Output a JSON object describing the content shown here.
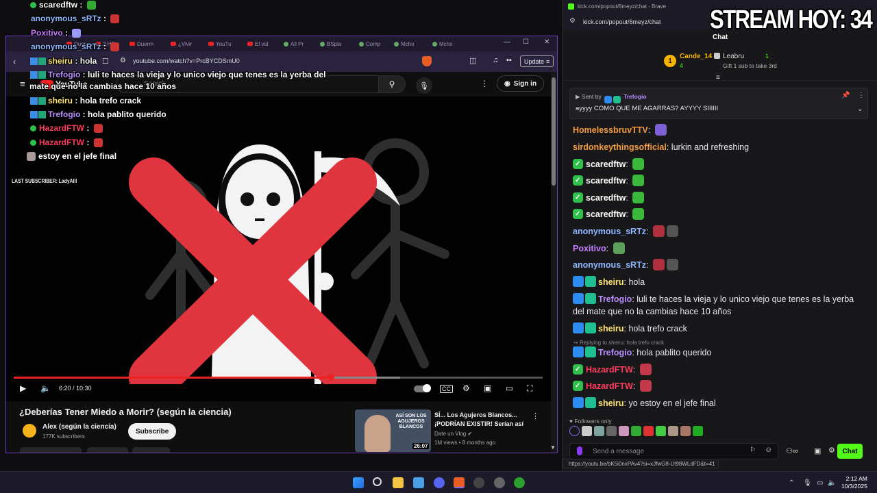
{
  "overlay": {
    "lines": [
      {
        "user": "scaredftw",
        "text": "",
        "color": "#ffffff",
        "badge": "check"
      },
      {
        "user": "anonymous_sRTz",
        "text": "",
        "color": "#8fb7ff",
        "badge": "none"
      },
      {
        "user": "Poxitivo",
        "text": "",
        "color": "#c77dff",
        "badge": "none"
      },
      {
        "user": "anonymous_sRTz",
        "text": "",
        "color": "#8fb7ff",
        "badge": "none"
      },
      {
        "user": "sheiru",
        "text": "hola",
        "color": "#ffe36e",
        "badge": "mod"
      },
      {
        "user": "Trefogio",
        "text": "luli te haces la vieja y lo unico viejo que tenes es la yerba del",
        "color": "#b98cff",
        "badge": "mod"
      },
      {
        "user": "",
        "text": "mate que no la cambias hace 10 años",
        "color": "#ffffff",
        "badge": "none"
      },
      {
        "user": "sheiru",
        "text": "hola trefo crack",
        "color": "#ffe36e",
        "badge": "mod"
      },
      {
        "user": "Trefogio",
        "text": "hola pablito querido",
        "color": "#b98cff",
        "badge": "mod"
      },
      {
        "user": "HazardFTW",
        "text": "",
        "color": "#ff3b5c",
        "badge": "check"
      },
      {
        "user": "HazardFTW",
        "text": "",
        "color": "#ff3b5c",
        "badge": "check"
      },
      {
        "user": "",
        "text": "estoy en el jefe final",
        "color": "#ffffff",
        "badge": "emote"
      }
    ],
    "last_subscriber": "LAST SUBSCRIBER: LadyAlll"
  },
  "browser": {
    "tabs": [
      "Duerm",
      "2 HO",
      "Duerm",
      "¿Vivir",
      "YouTu",
      "El vid",
      "All Pr",
      "BSpla",
      "Comp",
      "Mcho",
      "Mcho"
    ],
    "url": "youtube.com/watch?v=PrcBYCDSmU0",
    "update_label": "Update",
    "youtube_logo": "YouTube",
    "search_placeholder": "Search",
    "signin_label": "Sign in"
  },
  "player": {
    "progress": 0.6,
    "buffered": 0.73,
    "current_time": "6:20",
    "duration": "10:30",
    "time_display": "6:20 / 10:30"
  },
  "video": {
    "title": "¿Deberías Tener Miedo a Morir? (según la ciencia)",
    "channel": "Alex (según la ciencia)",
    "subscribers": "177K subscribers",
    "subscribe_label": "Subscribe"
  },
  "recommendation": {
    "thumb_text": "ASÍ SON LOS AGUJEROS BLANCOS",
    "duration": "26:07",
    "title": "SÍ... Los Agujeros Blancos... ¡PODRÍAN EXISTIR! Serían así",
    "channel": "Date un Vlog",
    "meta": "1M views • 8 months ago"
  },
  "kick": {
    "window_title": "kick.com/popout/6meyz/chat - Brave",
    "url": "kick.com/popout/6meyz/chat",
    "chat_label": "Chat",
    "leaderboard": {
      "rank": "1",
      "user": "Cande_14",
      "count": "4",
      "user2": "Leabru",
      "count2": "1",
      "gift_text": "Gift 1 sub to take 3rd"
    },
    "pinned": {
      "sent_by_label": "Sent by",
      "user": "Trefogio",
      "text": "ayyyy COMO QUE ME AGARRAS? AYYYY SIIIIII"
    },
    "messages": [
      {
        "user": "HomelessbruvTTV",
        "text": "",
        "color": "#f49b3f",
        "badges": "none",
        "emotes": 1
      },
      {
        "user": "sirdonkeythingsofficial",
        "text": "lurkin and refreshing",
        "color": "#f49b3f",
        "badges": "none",
        "emotes": 0
      },
      {
        "user": "scaredftw",
        "text": "",
        "color": "#ffffff",
        "badges": "vip",
        "emotes": 1
      },
      {
        "user": "scaredftw",
        "text": "",
        "color": "#ffffff",
        "badges": "vip",
        "emotes": 1
      },
      {
        "user": "scaredftw",
        "text": "",
        "color": "#ffffff",
        "badges": "vip",
        "emotes": 1
      },
      {
        "user": "scaredftw",
        "text": "",
        "color": "#ffffff",
        "badges": "vip",
        "emotes": 1
      },
      {
        "user": "anonymous_sRTz",
        "text": "",
        "color": "#8fb7ff",
        "badges": "none",
        "emotes": 2
      },
      {
        "user": "Poxitivo",
        "text": "",
        "color": "#c77dff",
        "badges": "none",
        "emotes": 1
      },
      {
        "user": "anonymous_sRTz",
        "text": "",
        "color": "#8fb7ff",
        "badges": "none",
        "emotes": 2
      },
      {
        "user": "sheiru",
        "text": "hola",
        "color": "#ffe36e",
        "badges": "mod",
        "emotes": 0
      },
      {
        "user": "Trefogio",
        "text": "luli te haces la vieja y lo unico viejo que tenes es la yerba del mate que no la cambias hace 10 años",
        "color": "#b98cff",
        "badges": "mod",
        "emotes": 0
      },
      {
        "user": "sheiru",
        "text": "hola trefo crack",
        "color": "#ffe36e",
        "badges": "mod",
        "emotes": 0
      },
      {
        "user": "Trefogio",
        "text": "hola pablito querido",
        "color": "#b98cff",
        "badges": "mod",
        "emotes": 0
      },
      {
        "user": "HazardFTW",
        "text": "",
        "color": "#ff3b5c",
        "badges": "vip",
        "emotes": 1
      },
      {
        "user": "HazardFTW",
        "text": "",
        "color": "#ff3b5c",
        "badges": "vip",
        "emotes": 1
      },
      {
        "user": "sheiru",
        "text": "yo estoy en el jefe final",
        "color": "#ffe36e",
        "badges": "mod",
        "emotes": 0
      }
    ],
    "reply_hint": "Replying to sheiru: hola trefo crack",
    "followers_only": "Followers only",
    "input_placeholder": "Send a message",
    "chat_button": "Chat",
    "status_url": "https://youtu.be/bK5i0nxPAv4?si=xJfwG8-Ut98WLdFD&t=41"
  },
  "stream_counter": "STREAM HOY: 34",
  "taskbar": {
    "time": "2:12 AM",
    "date": "10/3/2025"
  },
  "colors": {
    "kick_green": "#53fc18",
    "youtube_red": "#e22222",
    "big_x_red": "#e0343e",
    "browser_border": "#6c3cc7"
  }
}
